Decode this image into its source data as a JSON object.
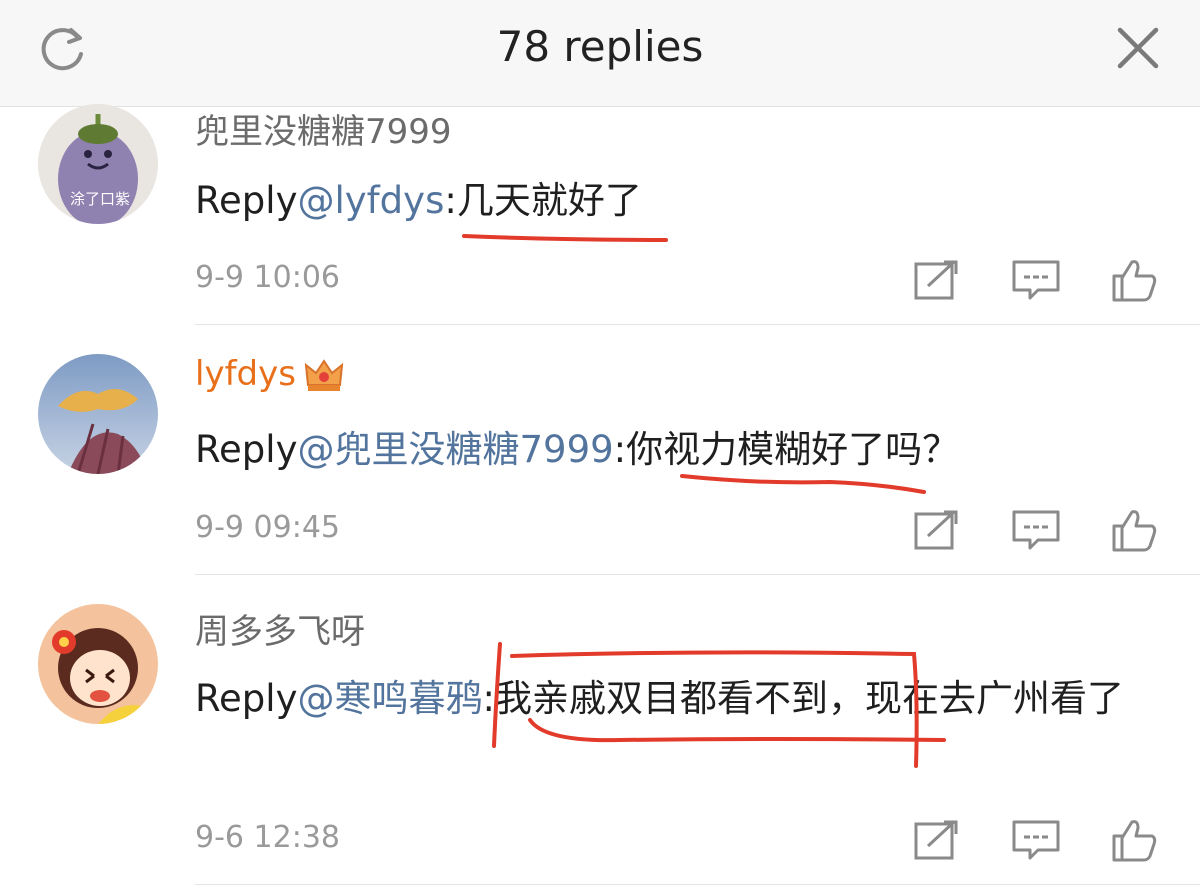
{
  "header": {
    "title": "78 replies"
  },
  "icons": {
    "refresh": "refresh-icon",
    "close": "close-icon",
    "repost": "repost-icon",
    "comment": "comment-icon",
    "like": "like-icon",
    "crown": "vip-crown-icon"
  },
  "colors": {
    "mention": "#52749d",
    "vip_username": "#e8701a",
    "annotation_red": "#e23b2b"
  },
  "comments": [
    {
      "username": "兜里没糖糖7999",
      "avatar_text": "涂了口紫",
      "reply_prefix": "Reply",
      "mention": "@lyfdys",
      "text": ":几天就好了",
      "time": "9-9 10:06"
    },
    {
      "username": "lyfdys",
      "reply_prefix": "Reply",
      "mention": "@兜里没糖糖7999",
      "text": ":你视力模糊好了吗？",
      "time": "9-9 09:45"
    },
    {
      "username": "周多多飞呀",
      "reply_prefix": "Reply",
      "mention": "@寒鸣暮鸦",
      "text": ":我亲戚双目都看不到，现在去广州看了",
      "time": "9-6 12:38"
    }
  ]
}
